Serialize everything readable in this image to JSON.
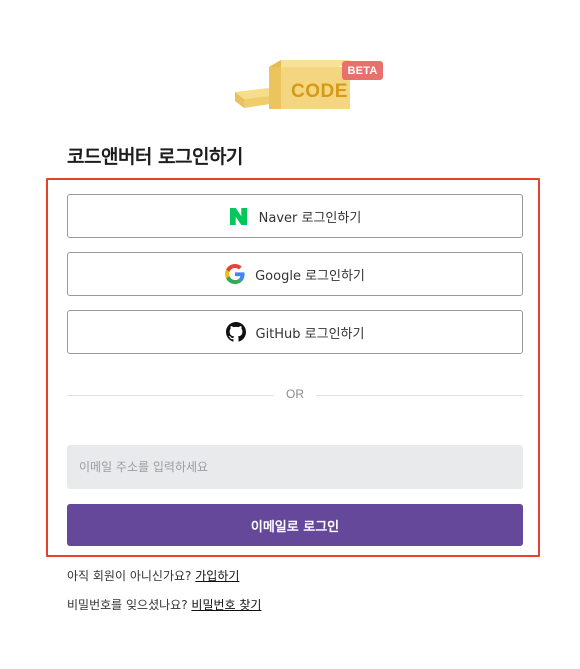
{
  "logo": {
    "text": "CODE",
    "badge": "BETA",
    "colors": {
      "cheese": "#f2d27a",
      "cheese_dark": "#e6bb4f",
      "text": "#d49a1a",
      "badge": "#e8716b"
    }
  },
  "page": {
    "title": "코드앤버터 로그인하기"
  },
  "social": {
    "naver": {
      "label": "Naver 로그인하기",
      "icon": "naver-n-icon",
      "color": "#03c75a"
    },
    "google": {
      "label": "Google 로그인하기",
      "icon": "google-g-icon"
    },
    "github": {
      "label": "GitHub 로그인하기",
      "icon": "github-octocat-icon"
    }
  },
  "divider": {
    "label": "OR"
  },
  "email": {
    "placeholder": "이메일 주소를 입력하세요",
    "value": "",
    "button_label": "이메일로 로그인",
    "button_color": "#65489a"
  },
  "footer": {
    "signup_prompt": "아직 회원이 아니신가요?",
    "signup_link": "가입하기",
    "reset_prompt": "비밀번호를 잊으셨나요?",
    "reset_link": "비밀번호 찾기"
  },
  "highlight_color": "#e8412b"
}
